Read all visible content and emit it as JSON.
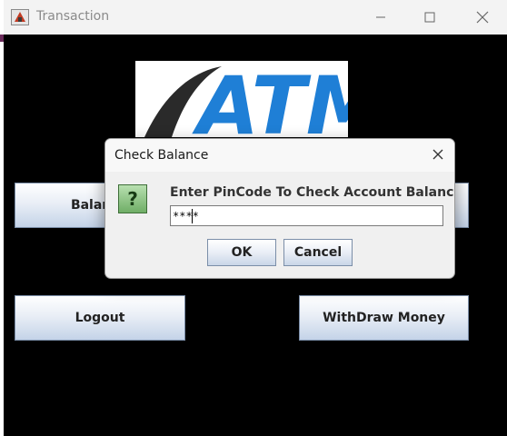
{
  "window": {
    "title": "Transaction",
    "app_icon": "java-app-icon",
    "controls": [
      "minimize-icon",
      "maximize-icon",
      "close-icon"
    ]
  },
  "main": {
    "logo_text": "ATM",
    "buttons": {
      "balance": "Balance",
      "logout": "Logout",
      "withdraw": "WithDraw Money"
    }
  },
  "dialog": {
    "title": "Check Balance",
    "icon": "question-icon",
    "message": "Enter PinCode To Check Account Balance",
    "pin_value": "****",
    "ok_label": "OK",
    "cancel_label": "Cancel"
  },
  "colors": {
    "content_bg": "#000000",
    "logo_blue": "#1f7fd6",
    "button_gradient_bottom": "#c4d3e8"
  }
}
